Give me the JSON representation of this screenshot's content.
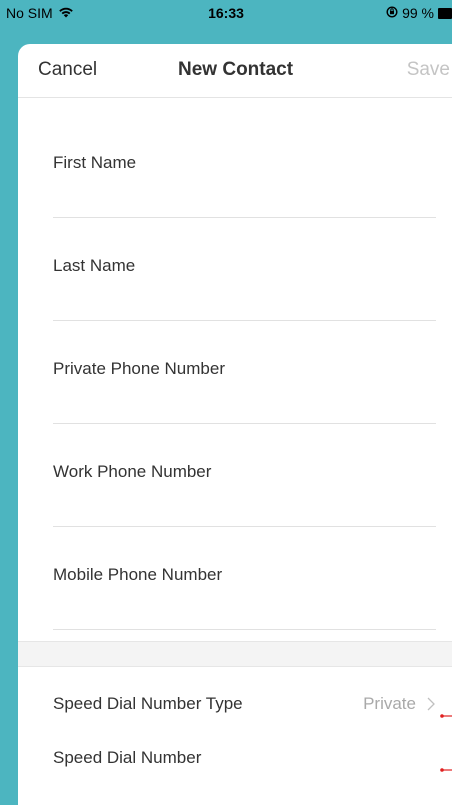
{
  "status_bar": {
    "carrier": "No SIM",
    "time": "16:33",
    "battery": "99 %"
  },
  "nav": {
    "cancel_label": "Cancel",
    "title": "New Contact",
    "save_label": "Save"
  },
  "form": {
    "fields": [
      {
        "label": "First Name",
        "value": ""
      },
      {
        "label": "Last Name",
        "value": ""
      },
      {
        "label": "Private Phone Number",
        "value": ""
      },
      {
        "label": "Work Phone Number",
        "value": ""
      },
      {
        "label": "Mobile Phone Number",
        "value": ""
      }
    ]
  },
  "speed_dial": {
    "type_label": "Speed Dial Number Type",
    "type_value": "Private",
    "number_label": "Speed Dial Number"
  },
  "colors": {
    "accent": "#4cb5c0",
    "marker": "#e02020",
    "disabled": "#c4c4c4"
  }
}
